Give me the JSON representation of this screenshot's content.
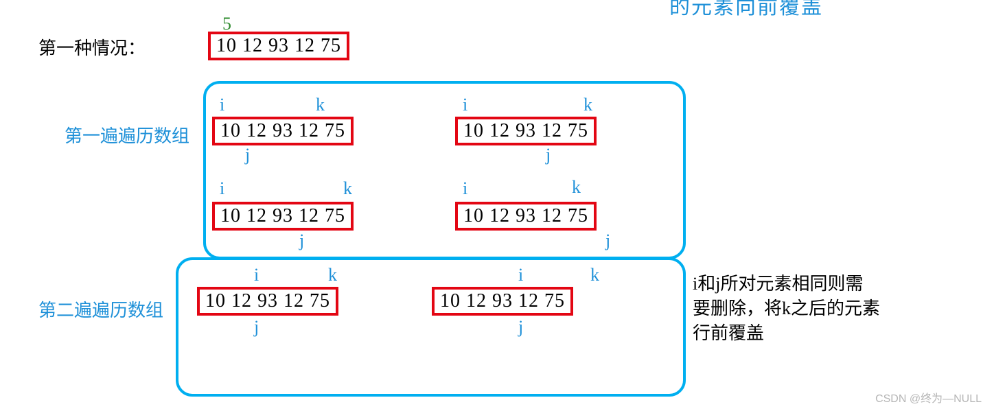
{
  "top_cutoff_text": "的元素向前覆盖",
  "case_title": "第一种情况：",
  "size_label": "5",
  "array_text": "10  12  93  12  75",
  "pass1_label": "第一遍遍历数组",
  "pass2_label": "第二遍遍历数组",
  "idx_i": "i",
  "idx_j": "j",
  "idx_k": "k",
  "explain_line1": "i和j所对元素相同则需",
  "explain_line2": "要删除，将k之后的元素",
  "explain_line3": "行前覆盖",
  "watermark": "CSDN @终为—NULL"
}
